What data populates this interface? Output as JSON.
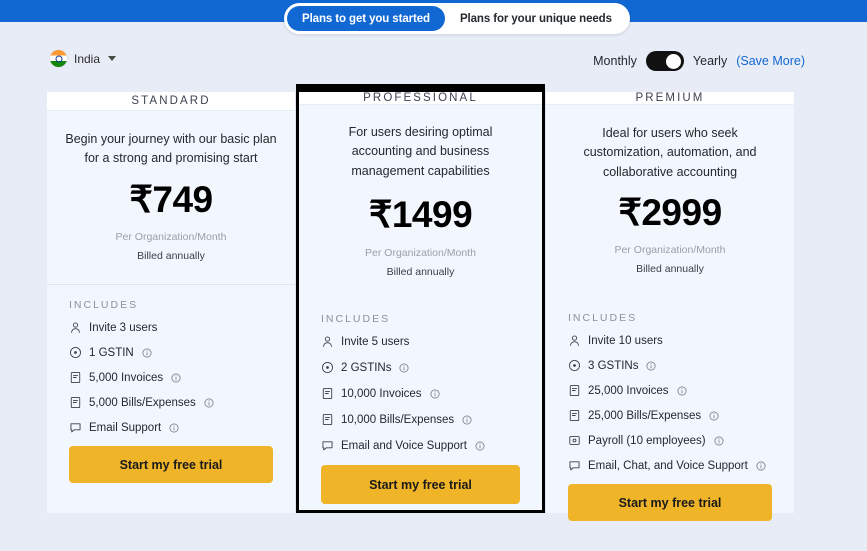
{
  "topbar": {
    "tabs": [
      {
        "label": "Plans to get you started",
        "active": true
      },
      {
        "label": "Plans for your unique needs",
        "active": false
      }
    ],
    "accent_color": "#1268d3"
  },
  "controls": {
    "country": {
      "label": "India",
      "flag": "india-flag-icon"
    },
    "billing": {
      "monthly_label": "Monthly",
      "yearly_label": "Yearly",
      "save_more_label": "(Save More)",
      "selected": "Yearly",
      "link_color": "#1268d3"
    }
  },
  "includes_label": "INCLUDES",
  "cta_label": "Start my free trial",
  "cta_color": "#f0b429",
  "plans": [
    {
      "name": "STANDARD",
      "description": "Begin your journey with our basic plan for a strong and promising start",
      "price": "₹749",
      "per_org": "Per Organization/Month",
      "billed": "Billed annually",
      "featured": false,
      "features": [
        {
          "icon": "user-icon",
          "text": "Invite 3 users",
          "info": false
        },
        {
          "icon": "gstin-icon",
          "text": "1 GSTIN",
          "info": true
        },
        {
          "icon": "document-icon",
          "text": "5,000 Invoices",
          "info": true
        },
        {
          "icon": "document-icon",
          "text": "5,000 Bills/Expenses",
          "info": true
        },
        {
          "icon": "chat-icon",
          "text": "Email Support",
          "info": true
        }
      ]
    },
    {
      "name": "PROFESSIONAL",
      "description": "For users desiring optimal accounting and business management capabilities",
      "price": "₹1499",
      "per_org": "Per Organization/Month",
      "billed": "Billed annually",
      "featured": true,
      "features": [
        {
          "icon": "user-icon",
          "text": "Invite 5 users",
          "info": false
        },
        {
          "icon": "gstin-icon",
          "text": "2 GSTINs",
          "info": true
        },
        {
          "icon": "document-icon",
          "text": "10,000 Invoices",
          "info": true
        },
        {
          "icon": "document-icon",
          "text": "10,000 Bills/Expenses",
          "info": true
        },
        {
          "icon": "chat-icon",
          "text": "Email and Voice Support",
          "info": true
        }
      ]
    },
    {
      "name": "PREMIUM",
      "description": "Ideal for users who seek customization, automation, and collaborative accounting",
      "price": "₹2999",
      "per_org": "Per Organization/Month",
      "billed": "Billed annually",
      "featured": false,
      "features": [
        {
          "icon": "user-icon",
          "text": "Invite 10 users",
          "info": false
        },
        {
          "icon": "gstin-icon",
          "text": "3 GSTINs",
          "info": true
        },
        {
          "icon": "document-icon",
          "text": "25,000 Invoices",
          "info": true
        },
        {
          "icon": "document-icon",
          "text": "25,000 Bills/Expenses",
          "info": true
        },
        {
          "icon": "payroll-icon",
          "text": "Payroll (10 employees)",
          "info": true
        },
        {
          "icon": "chat-icon",
          "text": "Email, Chat, and Voice Support",
          "info": true
        }
      ]
    }
  ]
}
